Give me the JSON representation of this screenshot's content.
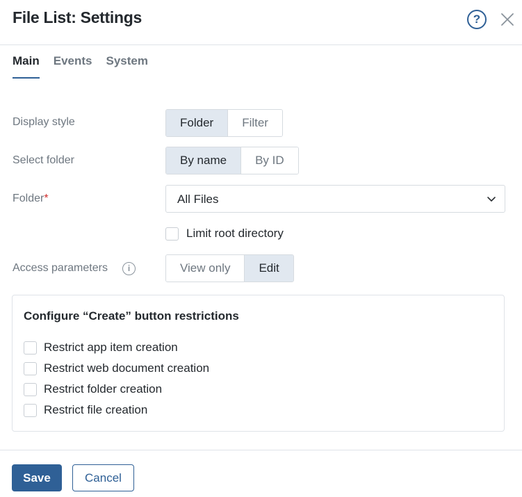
{
  "header": {
    "title": "File List: Settings",
    "help_icon": "question-circle-icon",
    "help_glyph": "?",
    "close_icon": "close-icon"
  },
  "tabs": [
    {
      "label": "Main",
      "active": true
    },
    {
      "label": "Events",
      "active": false
    },
    {
      "label": "System",
      "active": false
    }
  ],
  "display_style": {
    "label": "Display style",
    "options": [
      "Folder",
      "Filter"
    ],
    "selected": "Folder"
  },
  "select_folder": {
    "label": "Select folder",
    "options": [
      "By name",
      "By ID"
    ],
    "selected": "By name"
  },
  "folder": {
    "label": "Folder",
    "required_mark": "*",
    "value": "All Files"
  },
  "limit_root": {
    "label": "Limit root directory",
    "checked": false
  },
  "access": {
    "label": "Access parameters",
    "info_glyph": "i",
    "options": [
      "View only",
      "Edit"
    ],
    "selected": "Edit"
  },
  "restrictions": {
    "title": "Configure “Create” button restrictions",
    "items": [
      {
        "label": "Restrict app item creation",
        "checked": false
      },
      {
        "label": "Restrict web document creation",
        "checked": false
      },
      {
        "label": "Restrict folder creation",
        "checked": false
      },
      {
        "label": "Restrict file creation",
        "checked": false
      }
    ]
  },
  "footer": {
    "save_label": "Save",
    "cancel_label": "Cancel"
  },
  "colors": {
    "accent": "#2f6096",
    "segment_active": "#e1e8f0",
    "required": "#d0302f"
  }
}
